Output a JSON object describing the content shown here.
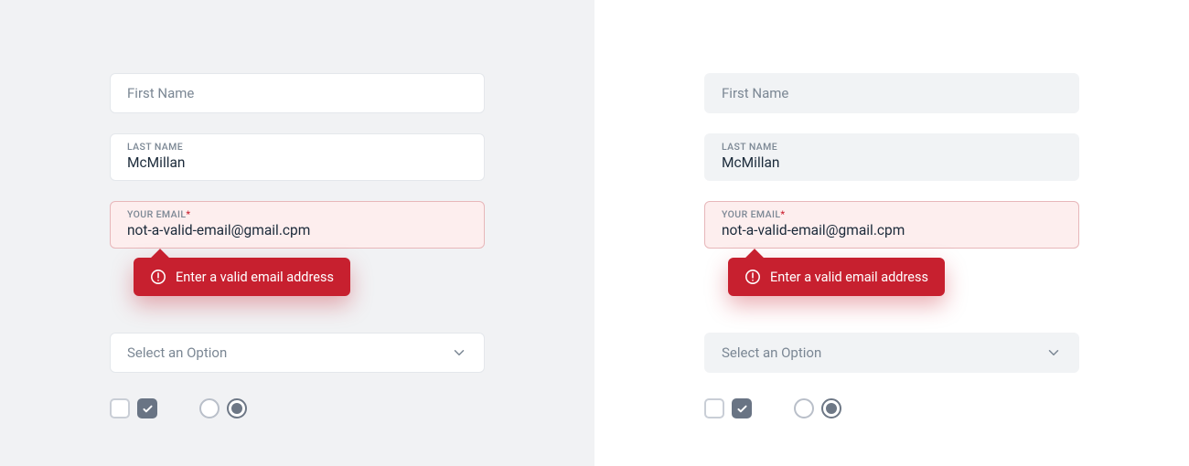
{
  "form": {
    "first_name": {
      "placeholder": "First Name"
    },
    "last_name": {
      "label": "LAST NAME",
      "value": "McMillan"
    },
    "email": {
      "label": "YOUR EMAIL",
      "value": "not-a-valid-email@gmail.cpm",
      "required_mark": "*"
    },
    "error": {
      "message": "Enter a valid email address"
    },
    "select": {
      "placeholder": "Select an Option"
    }
  }
}
